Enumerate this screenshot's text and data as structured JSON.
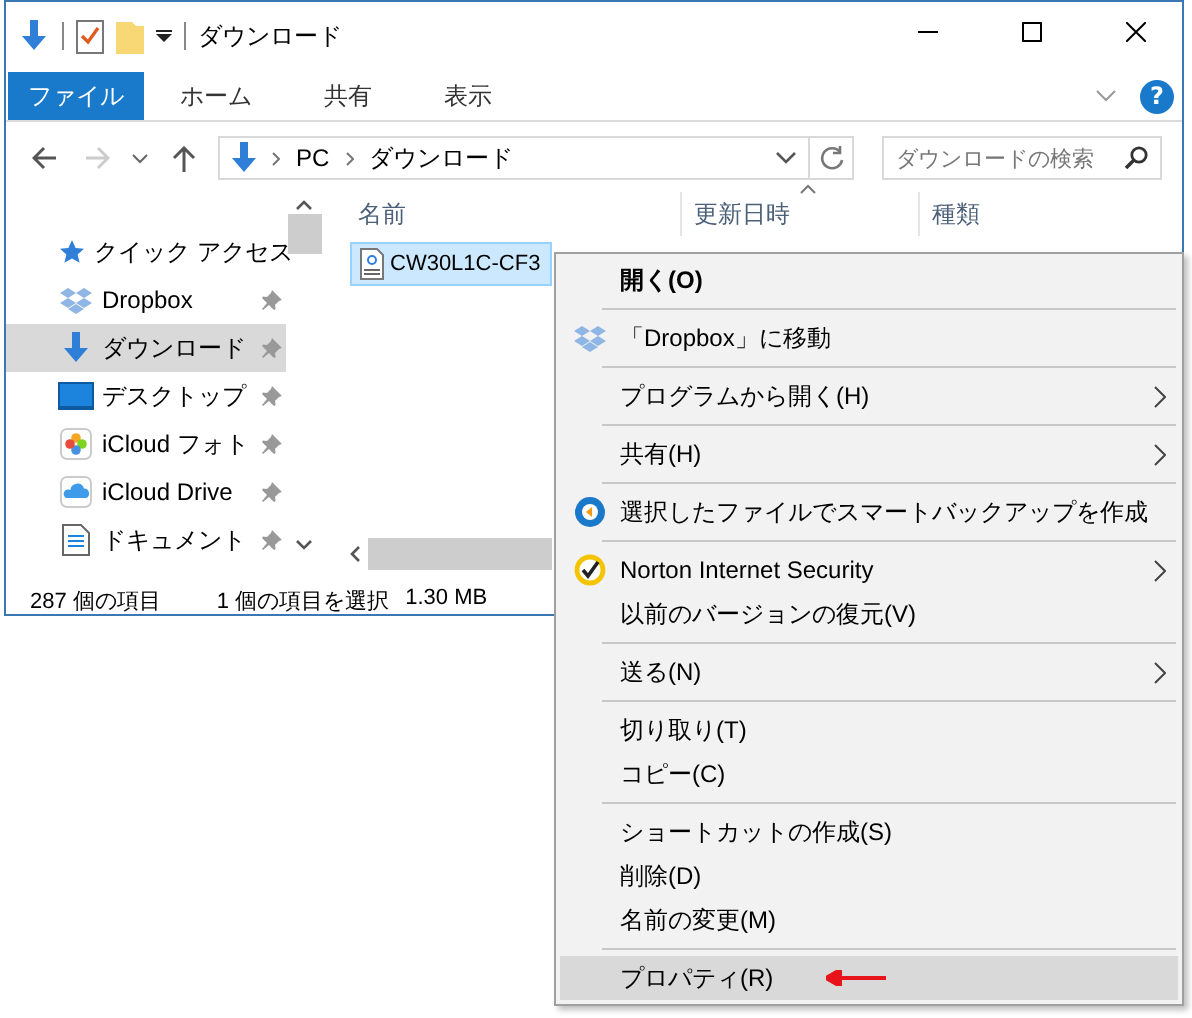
{
  "window": {
    "title": "ダウンロード",
    "help": "?"
  },
  "ribbon_tabs": [
    {
      "label": "ファイル",
      "kind": "file"
    },
    {
      "label": "ホーム",
      "kind": "tab"
    },
    {
      "label": "共有",
      "kind": "tab"
    },
    {
      "label": "表示",
      "kind": "tab"
    }
  ],
  "address": {
    "crumbs": [
      "PC",
      "ダウンロード"
    ]
  },
  "search": {
    "placeholder": "ダウンロードの検索"
  },
  "sidebar": {
    "items": [
      {
        "label": "クイック アクセス",
        "kind": "star",
        "pinned": false,
        "selected": false
      },
      {
        "label": "Dropbox",
        "kind": "dropbox",
        "pinned": true,
        "selected": false
      },
      {
        "label": "ダウンロード",
        "kind": "download",
        "pinned": true,
        "selected": true
      },
      {
        "label": "デスクトップ",
        "kind": "desktop",
        "pinned": true,
        "selected": false
      },
      {
        "label": "iCloud フォト",
        "kind": "photos",
        "pinned": true,
        "selected": false
      },
      {
        "label": "iCloud Drive",
        "kind": "cloud",
        "pinned": true,
        "selected": false
      },
      {
        "label": "ドキュメント",
        "kind": "document",
        "pinned": true,
        "selected": false
      }
    ]
  },
  "table": {
    "columns": [
      "名前",
      "更新日時",
      "種類"
    ],
    "rows": [
      {
        "name": "CW30L1C-CF3",
        "selected": true
      }
    ]
  },
  "status_bar": {
    "item_count": "287 個の項目",
    "selection": "1 個の項目を選択",
    "size": "1.30 MB"
  },
  "context_menu": {
    "groups": [
      [
        {
          "label": "開く(O)",
          "default": true,
          "submenu": false,
          "selected": false,
          "arrowed": false
        }
      ],
      [
        {
          "label": "「Dropbox」に移動",
          "kind": "dropbox",
          "default": false,
          "submenu": false,
          "selected": false,
          "arrowed": false
        }
      ],
      [
        {
          "label": "プログラムから開く(H)",
          "default": false,
          "submenu": true,
          "selected": false,
          "arrowed": false
        }
      ],
      [
        {
          "label": "共有(H)",
          "default": false,
          "submenu": true,
          "selected": false,
          "arrowed": false
        }
      ],
      [
        {
          "label": "選択したファイルでスマートバックアップを作成",
          "kind": "backup",
          "default": false,
          "submenu": false,
          "selected": false,
          "arrowed": false
        }
      ],
      [
        {
          "label": "Norton Internet Security",
          "kind": "norton",
          "default": false,
          "submenu": true,
          "selected": false,
          "arrowed": false
        },
        {
          "label": "以前のバージョンの復元(V)",
          "default": false,
          "submenu": false,
          "selected": false,
          "arrowed": false
        }
      ],
      [
        {
          "label": "送る(N)",
          "default": false,
          "submenu": true,
          "selected": false,
          "arrowed": false
        }
      ],
      [
        {
          "label": "切り取り(T)",
          "default": false,
          "submenu": false,
          "selected": false,
          "arrowed": false
        },
        {
          "label": "コピー(C)",
          "default": false,
          "submenu": false,
          "selected": false,
          "arrowed": false
        }
      ],
      [
        {
          "label": "ショートカットの作成(S)",
          "default": false,
          "submenu": false,
          "selected": false,
          "arrowed": false
        },
        {
          "label": "削除(D)",
          "default": false,
          "submenu": false,
          "selected": false,
          "arrowed": false
        },
        {
          "label": "名前の変更(M)",
          "default": false,
          "submenu": false,
          "selected": false,
          "arrowed": false
        }
      ],
      [
        {
          "label": "プロパティ(R)",
          "default": false,
          "submenu": false,
          "selected": true,
          "arrowed": true
        }
      ]
    ]
  }
}
